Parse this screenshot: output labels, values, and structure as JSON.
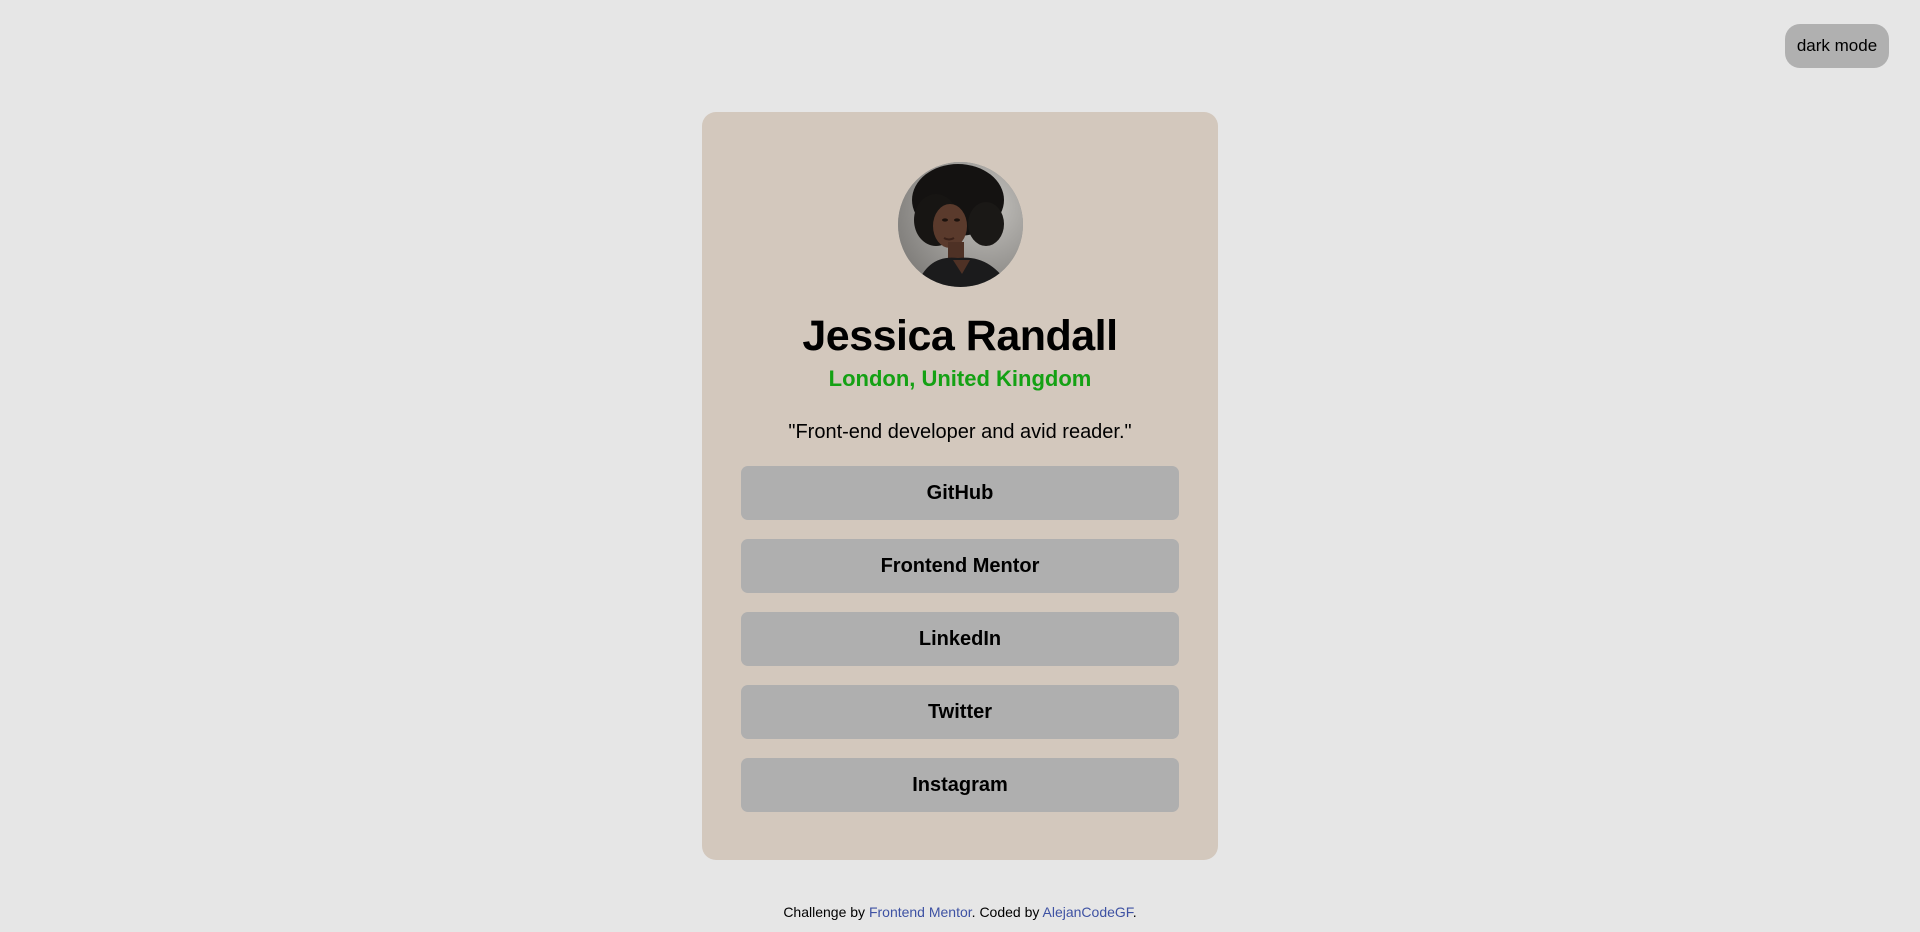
{
  "header": {
    "theme_toggle_label": "dark mode"
  },
  "profile": {
    "name": "Jessica Randall",
    "location": "London, United Kingdom",
    "bio": "\"Front-end developer and avid reader.\"",
    "avatar_icon": "profile-photo",
    "location_color": "#14a114"
  },
  "links": [
    {
      "label": "GitHub"
    },
    {
      "label": "Frontend Mentor"
    },
    {
      "label": "LinkedIn"
    },
    {
      "label": "Twitter"
    },
    {
      "label": "Instagram"
    }
  ],
  "footer": {
    "prefix": "Challenge by ",
    "challenge_link": "Frontend Mentor",
    "middle": ". Coded by ",
    "author_link": "AlejanCodeGF",
    "suffix": ".",
    "link_color": "#3e52a3"
  },
  "colors": {
    "page_background": "#e6e6e6",
    "card_background": "#d3c8bd",
    "button_background": "#afafaf"
  }
}
